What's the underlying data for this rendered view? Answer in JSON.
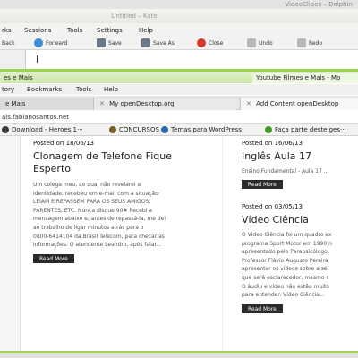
{
  "dolphin": {
    "title": "VideoClipes – Dolphin"
  },
  "kate": {
    "title": "Untitled – Kate",
    "menu": [
      "rks",
      "Sessions",
      "Tools",
      "Settings",
      "Help"
    ],
    "toolbar": {
      "back": "Back",
      "forward": "Forward",
      "save": "Save",
      "save_as": "Save As",
      "close": "Close",
      "undo": "Undo",
      "redo": "Redo"
    }
  },
  "browser": {
    "tabs_top": {
      "left": "es e Mais",
      "right": "Youtube Filmes e Mais - Mo"
    },
    "menu": [
      "tory",
      "Bookmarks",
      "Tools",
      "Help"
    ],
    "tabs": [
      {
        "label": "e Mais"
      },
      {
        "label": "My openDesktop.org"
      },
      {
        "label": "Add  Content openDesktop"
      }
    ],
    "url": "ais.fabianosantos.net",
    "bookmarks": [
      {
        "label": "Download - Heroes 1···",
        "icon": "download-icon",
        "color": "#3a3a3a"
      },
      {
        "label": "CONCURSOS",
        "icon": "bookmark-icon",
        "color": "#7a5a2a"
      },
      {
        "label": "Temas para WordPress",
        "icon": "wordpress-icon",
        "color": "#2a6aa8"
      },
      {
        "label": "Faça parte deste ges···",
        "icon": "leaf-icon",
        "color": "#4a9a2a"
      }
    ]
  },
  "posts": {
    "left": {
      "date": "Posted on 18/06/13",
      "title_lines": [
        "Clonagem de Telefone Fique",
        "Esperto"
      ],
      "excerpt_lines": [
        "Um colega meu, ao qual não revelarei a",
        "identidade, recebeu um e-mail com a situação:",
        "LEIAM E REPASSEM PARA OS SEUS AMIGOS,",
        "PARENTES, ETC. Nunca disque 90# Recebi a",
        "mensagem abaixo e, antes de repassá-la, me dei",
        "ao trabalho de ligar minutos atrás para o",
        "0800-6414104 da Brasil Telecom, para checar as",
        "informações. O atendente Leandro, após falar..."
      ],
      "read_more": "Read More"
    },
    "right1": {
      "date": "Posted on 16/06/13",
      "title": "Inglês Aula 17",
      "excerpt": "Ensino Fundamental - Aula 17 ...",
      "read_more": "Read More"
    },
    "right2": {
      "date": "Posted on 03/05/13",
      "title": "Vídeo Ciência",
      "excerpt_lines": [
        "O Vídeo Ciência foi um quadro ex",
        "programa Sport Motor em 1990 n",
        "apresentado pelo Parapsicólogo",
        "Professor Flávio Augusto Pereira",
        "apresentar os vídeos sobre a séi",
        "que será esclarecedor, mesmo r",
        "O áudio e vídeo não estão muito",
        "para entender. Vídeo Ciência..."
      ],
      "read_more": "Read More"
    }
  },
  "colors": {
    "accent_green": "#9ed24f",
    "button_dark": "#2a2a2a"
  }
}
